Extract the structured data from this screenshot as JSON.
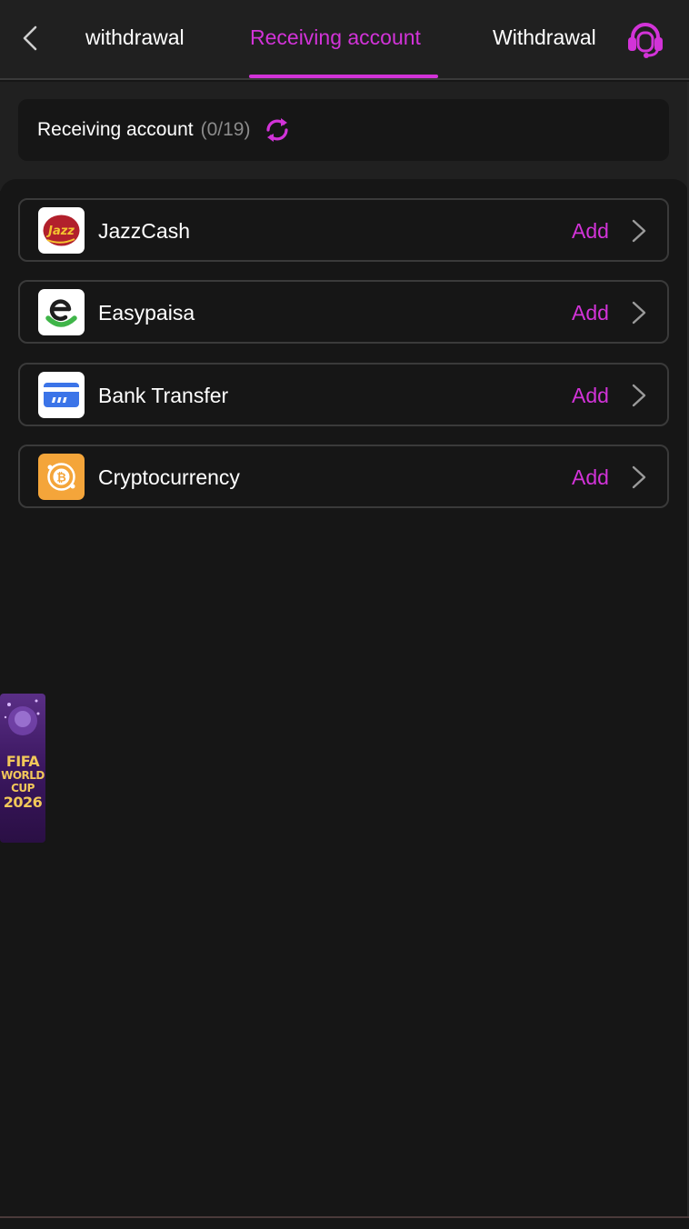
{
  "header": {
    "tabs": [
      {
        "label": "withdrawal"
      },
      {
        "label": "Receiving account"
      },
      {
        "label": "Withdrawal"
      }
    ],
    "active_tab": "Receiving account",
    "accent_color": "#d233d8",
    "back_icon": "chevron-left-icon",
    "support_icon": "headset-icon"
  },
  "account_bar": {
    "label": "Receiving account",
    "count": "(0/19)",
    "refresh_icon": "refresh-icon"
  },
  "methods": [
    {
      "name": "JazzCash",
      "action": "Add",
      "logo": "jazzcash-logo"
    },
    {
      "name": "Easypaisa",
      "action": "Add",
      "logo": "easypaisa-logo"
    },
    {
      "name": "Bank Transfer",
      "action": "Add",
      "logo": "bank-card-icon"
    },
    {
      "name": "Cryptocurrency",
      "action": "Add",
      "logo": "bitcoin-icon"
    }
  ],
  "banner": {
    "lines": [
      "FIFA",
      "WORLD",
      "CUP",
      "2026"
    ]
  }
}
